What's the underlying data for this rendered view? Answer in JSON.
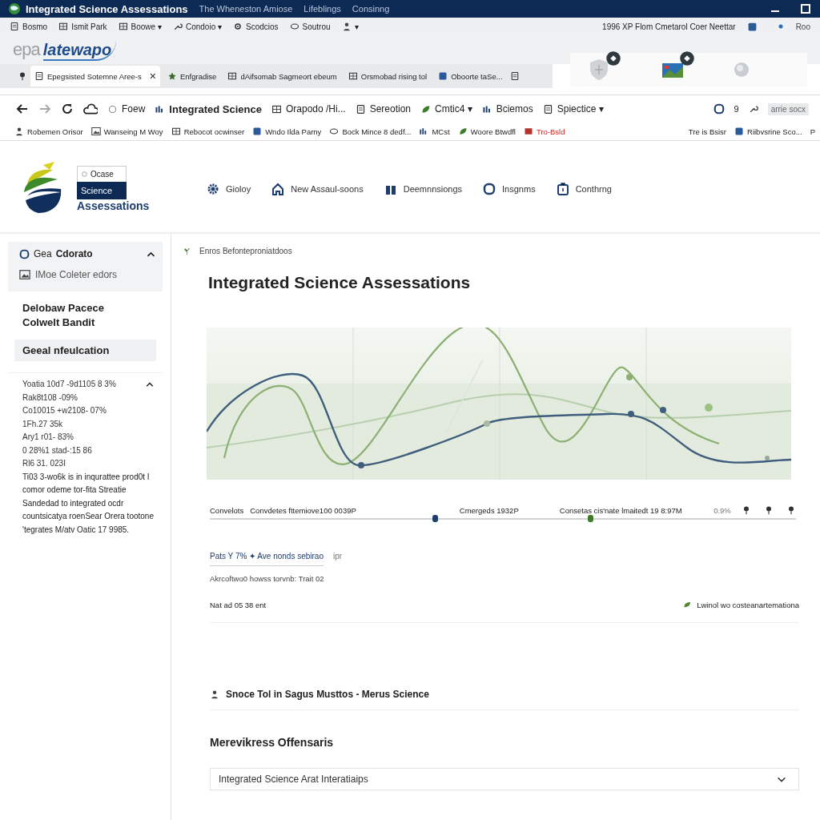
{
  "window": {
    "title": "Integrated Science Assessations",
    "title_menu": [
      "The Wheneston Amiose",
      "Lifeblings",
      "Consinng"
    ]
  },
  "menu_bar": {
    "items": [
      {
        "label": "Bosmo"
      },
      {
        "label": "Ismit Park"
      },
      {
        "label": "Boowe ▾"
      },
      {
        "label": "Condoio ▾"
      },
      {
        "label": "Scodcios"
      },
      {
        "label": "Soutrou"
      },
      {
        "label": "▾"
      }
    ],
    "right_text": "1996 XP Flom Cmetarol Coer Neettar",
    "right_label": "Roo"
  },
  "brand": {
    "prefix": "epa",
    "name": "latewapo"
  },
  "tabs": [
    {
      "label": "Epegsisted Sotemne Aree-s",
      "selected": true,
      "close": "×"
    },
    {
      "label": "Enfgradise",
      "selected": false
    },
    {
      "label": "dAifsomab Sagmeort ebeum",
      "selected": false
    },
    {
      "label": "Orsmobad rising tol",
      "selected": false
    },
    {
      "label": "Oboorte taSe...",
      "selected": false
    }
  ],
  "address_bar": {
    "items": [
      "Foew",
      "Integrated Science",
      "Orapodo /Hi...",
      "Sereotion",
      "Cmtic4 ▾",
      "Bciemos",
      "Spiectice ▾"
    ],
    "right_number": "9",
    "field": "arrie socx"
  },
  "bookmarks": {
    "left": [
      "Robemen Orisor",
      "Wanseing M Woy",
      "Rebocot ocwinser",
      "Wndo Ilda Parny",
      "Bock Mince 8 dedf...",
      "MCst",
      "Woore Btwdfl",
      "Tro-Bsld"
    ],
    "right": [
      "Tre is Bsisr",
      "Riibvsrine Sco...",
      "P"
    ]
  },
  "site_header": {
    "logo_top": "Ocase",
    "logo_band": "Science",
    "logo_bottom": "Assessations",
    "nav": [
      "Gioloy",
      "New Assaul-soons",
      "Deemnnsiongs",
      "Insgnms",
      "Conthrng"
    ]
  },
  "sidebar": {
    "panel": {
      "title_prefix": "Gea",
      "title": "Cdorato",
      "expanded": true,
      "item": "IMoe Coleter edors"
    },
    "heading_lines": [
      "Delobaw Pacece",
      "Colwelt Bandit"
    ],
    "section": "Geeal nfeulcation",
    "details": {
      "expanded": true,
      "lines": [
        "Yoatia 10d7 -9d1105 8 3%",
        "Rak8t108 -09%",
        "Co10015 +w2108- 07%",
        "1Fh.27 35k",
        "Ary1 r01- 83%",
        "0 28%1 stad-:15 86",
        "Rl6 31. 023I"
      ],
      "paragraph": "Ti03 3-wo6k is in inqurattee prod0t I comor odeme tor-fita Streatie Sandedad to integrated ocdr countsicatya roenSear Orera tootone 'tegrates M/atv Oatic 17 9985."
    }
  },
  "main": {
    "breadcrumb": "Enros Befonteproniatdoos",
    "title": "Integrated Science Assessations",
    "timeline": {
      "labels": [
        "Convelots",
        "Convdetes fttemiove100 0039P",
        "Cmergeds 1932P",
        "Consetas cis'nate lmaitedt 19 8:97M",
        "0.9%"
      ]
    },
    "stats_link": "Pats Y 7% ✦ Ave nonds sebirao",
    "stats_suffix": "ipr",
    "note": "Akrcoftwo0 howss torvnb: Trait 02",
    "time": "Nat ad 05 38 ent",
    "legend": "Lwinol wo costeanartemationa",
    "section_title": "Snoce Tol in Sagus Musttos - Merus Science",
    "subheading": "Merevikress Offensaris",
    "dropdown": {
      "value": "Integrated Science Arat Interatiaips",
      "expanded": false
    }
  }
}
